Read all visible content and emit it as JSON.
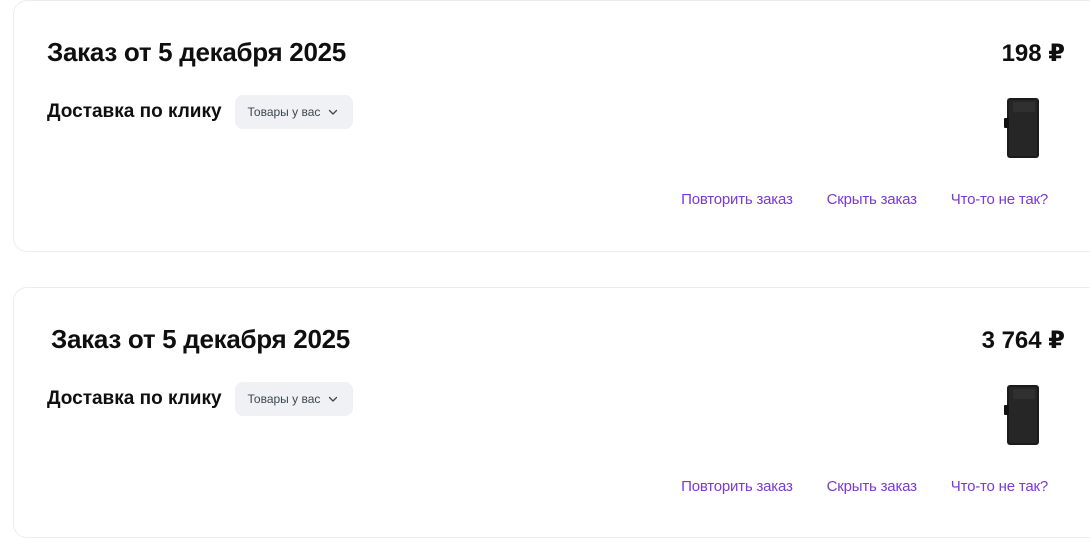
{
  "orders": [
    {
      "title": "Заказ от 5 декабря 2025",
      "price": "198 ₽",
      "delivery_label": "Доставка по клику",
      "status_chip": "Товары у вас",
      "actions": {
        "repeat": "Повторить заказ",
        "hide": "Скрыть заказ",
        "problem": "Что-то не так?"
      }
    },
    {
      "title": "Заказ от 5 декабря 2025",
      "price": "3 764 ₽",
      "delivery_label": "Доставка по клику",
      "status_chip": "Товары у вас",
      "actions": {
        "repeat": "Повторить заказ",
        "hide": "Скрыть заказ",
        "problem": "Что-то не так?"
      }
    }
  ],
  "colors": {
    "link": "#7b39d6",
    "chip_background": "#eff1f4",
    "text": "#0f0f0f"
  },
  "icons": {
    "chip": "chevron-down-icon",
    "product": "external-drive-icon"
  }
}
